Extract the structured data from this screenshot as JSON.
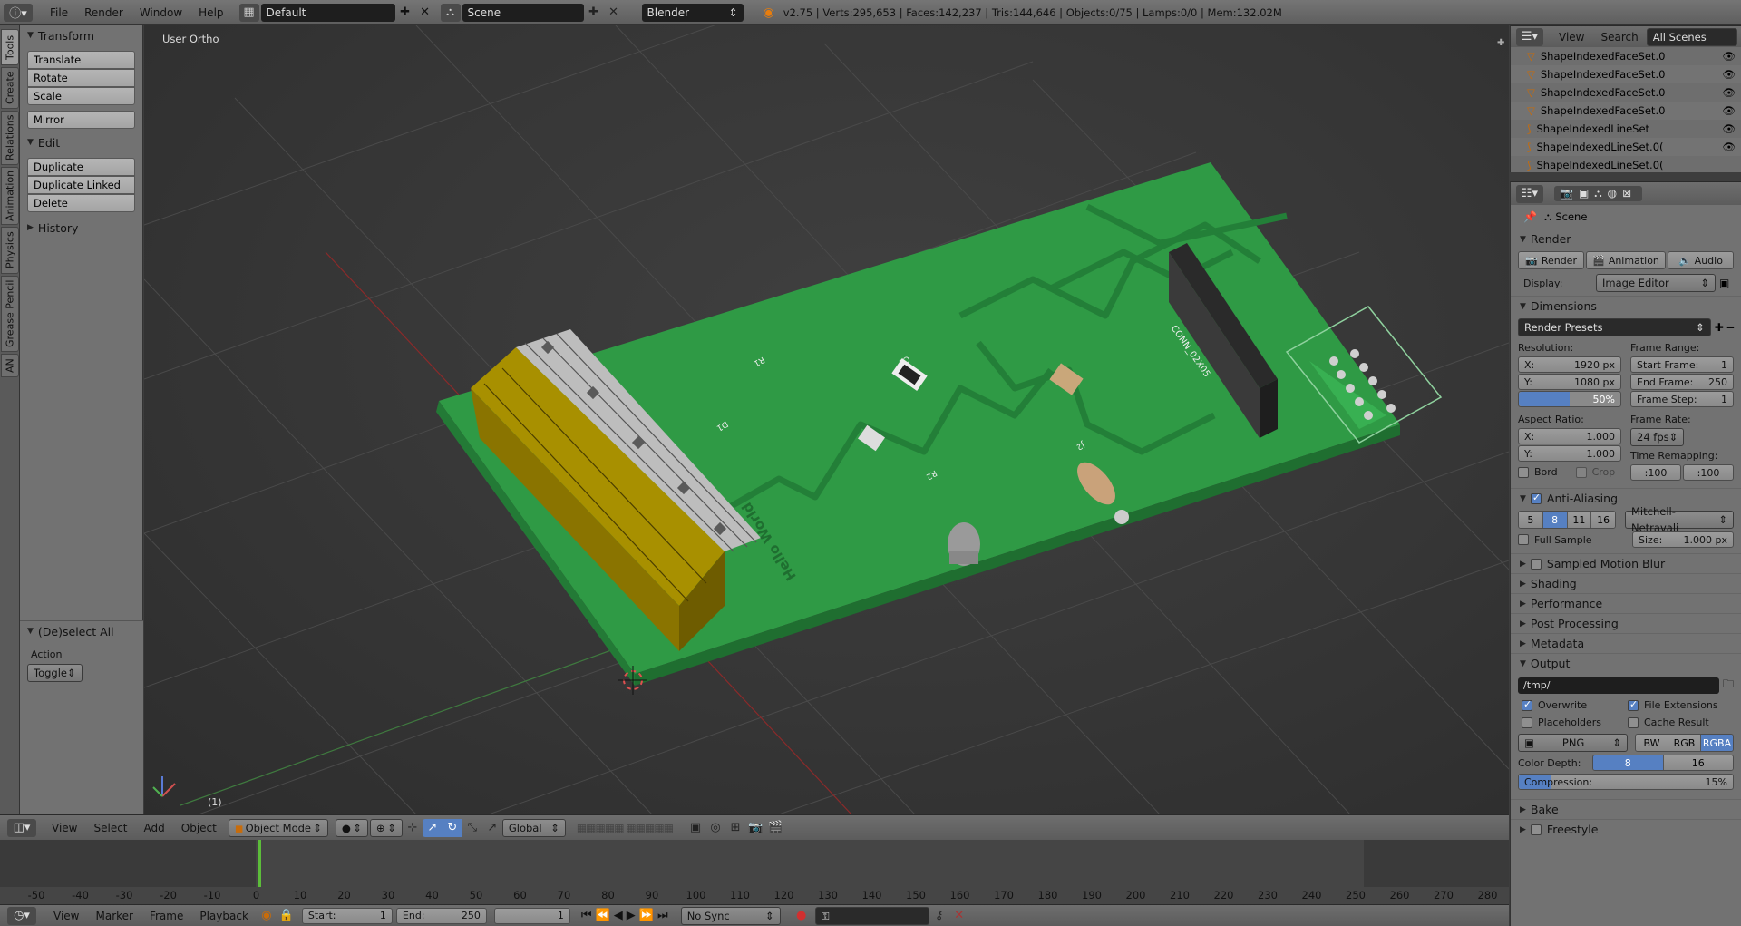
{
  "topbar": {
    "menus": [
      "File",
      "Render",
      "Window",
      "Help"
    ],
    "screen_layout": "Default",
    "scene": "Scene",
    "engine": "Blender Render",
    "stats": "v2.75 | Verts:295,653 | Faces:142,237 | Tris:144,646 | Objects:0/75 | Lamps:0/0 | Mem:132.02M"
  },
  "toolshelf": {
    "tabs": [
      "Tools",
      "Create",
      "Relations",
      "Animation",
      "Physics",
      "Grease Pencil",
      "AN"
    ],
    "transform": {
      "title": "Transform",
      "buttons": [
        "Translate",
        "Rotate",
        "Scale"
      ],
      "mirror": "Mirror"
    },
    "edit": {
      "title": "Edit",
      "buttons": [
        "Duplicate",
        "Duplicate Linked",
        "Delete"
      ]
    },
    "history": "History",
    "operator": {
      "title": "(De)select All",
      "action_label": "Action",
      "action_value": "Toggle"
    }
  },
  "viewport": {
    "view_label": "User Ortho",
    "frame_label": "(1)",
    "pcb_labels": [
      "R1",
      "D1",
      "C1",
      "R2",
      "J2",
      "CONN_02X05",
      "Hello World"
    ]
  },
  "view3d_header": {
    "menus": [
      "View",
      "Select",
      "Add",
      "Object"
    ],
    "mode": "Object Mode",
    "orientation": "Global"
  },
  "timeline": {
    "ticks": [
      "-50",
      "-40",
      "-30",
      "-20",
      "-10",
      "0",
      "10",
      "20",
      "30",
      "40",
      "50",
      "60",
      "70",
      "80",
      "90",
      "100",
      "110",
      "120",
      "130",
      "140",
      "150",
      "160",
      "170",
      "180",
      "190",
      "200",
      "210",
      "220",
      "230",
      "240",
      "250",
      "260",
      "270",
      "280"
    ],
    "current_frame_marker": 0,
    "menus": [
      "View",
      "Marker",
      "Frame",
      "Playback"
    ],
    "start_label": "Start:",
    "start_value": "1",
    "end_label": "End:",
    "end_value": "250",
    "current_value": "1",
    "sync": "No Sync"
  },
  "outliner": {
    "menus": [
      "View",
      "Search"
    ],
    "filter": "All Scenes",
    "items": [
      "ShapeIndexedFaceSet.0",
      "ShapeIndexedFaceSet.0",
      "ShapeIndexedFaceSet.0",
      "ShapeIndexedFaceSet.0",
      "ShapeIndexedLineSet",
      "ShapeIndexedLineSet.0(",
      "ShapeIndexedLineSet.0("
    ]
  },
  "properties": {
    "context": "Scene",
    "render": {
      "title": "Render",
      "buttons": [
        "Render",
        "Animation",
        "Audio"
      ],
      "display_label": "Display:",
      "display_value": "Image Editor"
    },
    "dimensions": {
      "title": "Dimensions",
      "presets": "Render Presets",
      "resolution_label": "Resolution:",
      "res_x": "1920 px",
      "res_y": "1080 px",
      "res_pct": "50%",
      "res_pct_fraction": 0.5,
      "frame_range_label": "Frame Range:",
      "start_frame": "1",
      "end_frame": "250",
      "frame_step": "1",
      "aspect_label": "Aspect Ratio:",
      "aspect_x": "1.000",
      "aspect_y": "1.000",
      "frame_rate_label": "Frame Rate:",
      "frame_rate": "24 fps",
      "time_remap_label": "Time Remapping:",
      "remap_old": ":100",
      "remap_new": ":100",
      "bord": "Bord",
      "crop": "Crop"
    },
    "anti_aliasing": {
      "title": "Anti-Aliasing",
      "samples": [
        "5",
        "8",
        "11",
        "16"
      ],
      "selected": "8",
      "filter": "Mitchell-Netravali",
      "full_sample": "Full Sample",
      "size_label": "Size:",
      "size_value": "1.000 px"
    },
    "collapsed": [
      "Sampled Motion Blur",
      "Shading",
      "Performance",
      "Post Processing",
      "Metadata"
    ],
    "output": {
      "title": "Output",
      "path": "/tmp/",
      "overwrite": "Overwrite",
      "file_extensions": "File Extensions",
      "placeholders": "Placeholders",
      "cache_result": "Cache Result",
      "format": "PNG",
      "color_modes": [
        "BW",
        "RGB",
        "RGBA"
      ],
      "color_mode_selected": "RGBA",
      "color_depth_label": "Color Depth:",
      "depths": [
        "8",
        "16"
      ],
      "compression_label": "Compression:",
      "compression": "15%",
      "compression_fraction": 0.15
    },
    "bottom": [
      "Bake",
      "Freestyle"
    ]
  }
}
